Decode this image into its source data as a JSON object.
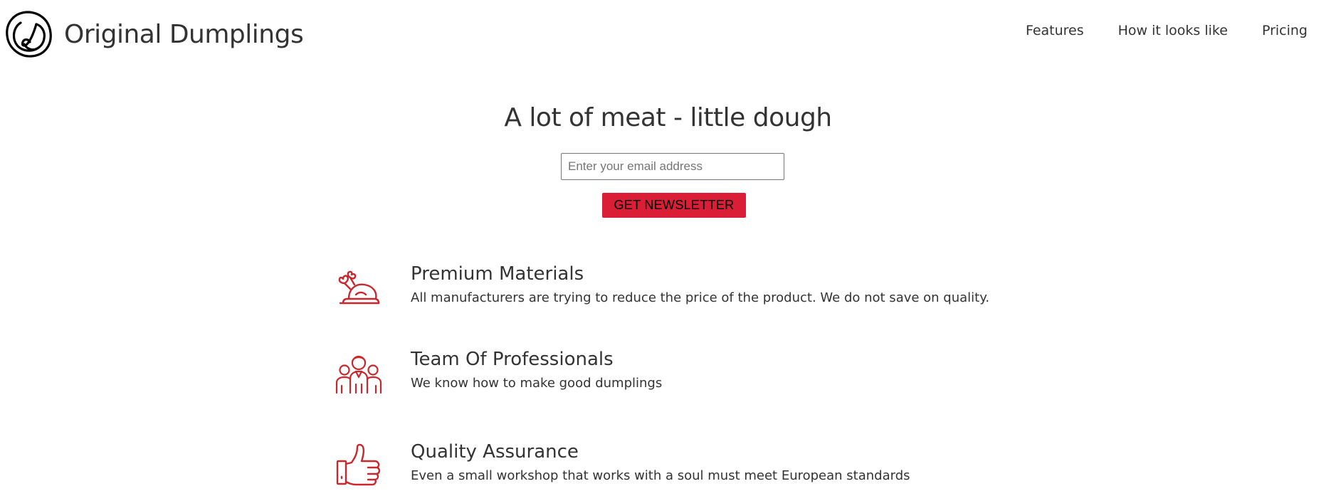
{
  "header": {
    "brand_name": "Original Dumplings",
    "nav": [
      {
        "label": "Features"
      },
      {
        "label": "How it looks like"
      },
      {
        "label": "Pricing"
      }
    ]
  },
  "hero": {
    "title": "A lot of meat - little dough",
    "email_placeholder": "Enter your email address",
    "email_value": "",
    "button_label": "GET NEWSLETTER"
  },
  "features": [
    {
      "icon": "roast-chicken-icon",
      "title": "Premium Materials",
      "description": "All manufacturers are trying to reduce the price of the product. We do not save on quality."
    },
    {
      "icon": "team-icon",
      "title": "Team Of Professionals",
      "description": "We know how to make good dumplings"
    },
    {
      "icon": "thumbs-up-icon",
      "title": "Quality Assurance",
      "description": "Even a small workshop that works with a soul must meet European standards"
    }
  ],
  "colors": {
    "accent": "#d91e36",
    "text": "#333333",
    "icon": "#c8282d"
  }
}
